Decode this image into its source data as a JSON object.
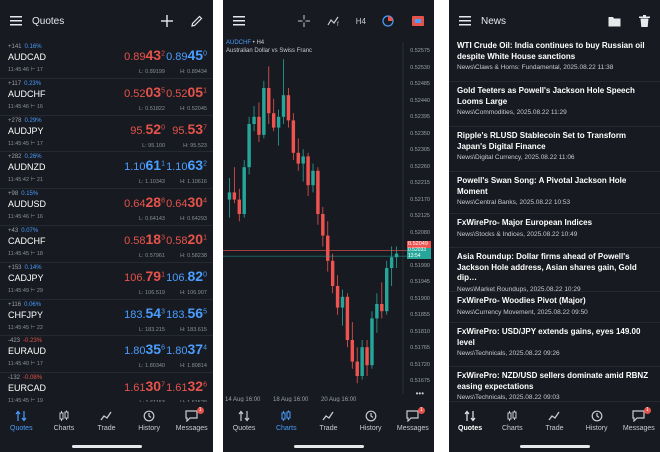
{
  "quotes": {
    "title": "Quotes",
    "rows": [
      {
        "change": "+141",
        "pct": "0.16%",
        "symbol": "AUDCAD",
        "time": "11:45:46",
        "spread": "17",
        "bid_main": "0.89",
        "bid_big": "43",
        "bid_sup": "2",
        "ask_main": "0.89",
        "ask_big": "45",
        "ask_sup": "0",
        "low": "L: 0.89199",
        "high": "H: 0.89434",
        "dir": "up",
        "bid_dir": "down",
        "ask_dir": "up"
      },
      {
        "change": "+117",
        "pct": "0.23%",
        "symbol": "AUDCHF",
        "time": "11:45:46",
        "spread": "16",
        "bid_main": "0.52",
        "bid_big": "03",
        "bid_sup": "5",
        "ask_main": "0.52",
        "ask_big": "05",
        "ask_sup": "1",
        "low": "L: 0.51822",
        "high": "H: 0.52045",
        "dir": "up",
        "bid_dir": "down",
        "ask_dir": "down"
      },
      {
        "change": "+278",
        "pct": "0.29%",
        "symbol": "AUDJPY",
        "time": "11:45:45",
        "spread": "17",
        "bid_main": "95.",
        "bid_big": "52",
        "bid_sup": "0",
        "ask_main": "95.",
        "ask_big": "53",
        "ask_sup": "7",
        "low": "L: 95.100",
        "high": "H: 95.523",
        "dir": "up",
        "bid_dir": "down",
        "ask_dir": "down"
      },
      {
        "change": "+282",
        "pct": "0.26%",
        "symbol": "AUDNZD",
        "time": "11:45:42",
        "spread": "21",
        "bid_main": "1.10",
        "bid_big": "61",
        "bid_sup": "1",
        "ask_main": "1.10",
        "ask_big": "63",
        "ask_sup": "2",
        "low": "L: 1.10343",
        "high": "H: 1.10616",
        "dir": "up",
        "bid_dir": "up",
        "ask_dir": "up"
      },
      {
        "change": "+98",
        "pct": "0.15%",
        "symbol": "AUDUSD",
        "time": "11:45:46",
        "spread": "16",
        "bid_main": "0.64",
        "bid_big": "28",
        "bid_sup": "8",
        "ask_main": "0.64",
        "ask_big": "30",
        "ask_sup": "4",
        "low": "L: 0.64143",
        "high": "H: 0.64293",
        "dir": "up",
        "bid_dir": "down",
        "ask_dir": "down"
      },
      {
        "change": "+43",
        "pct": "0.07%",
        "symbol": "CADCHF",
        "time": "11:45:45",
        "spread": "18",
        "bid_main": "0.58",
        "bid_big": "18",
        "bid_sup": "3",
        "ask_main": "0.58",
        "ask_big": "20",
        "ask_sup": "1",
        "low": "L: 0.57961",
        "high": "H: 0.58238",
        "dir": "up",
        "bid_dir": "down",
        "ask_dir": "down"
      },
      {
        "change": "+153",
        "pct": "0.14%",
        "symbol": "CADJPY",
        "time": "11:45:49",
        "spread": "29",
        "bid_main": "106.",
        "bid_big": "79",
        "bid_sup": "1",
        "ask_main": "106.",
        "ask_big": "82",
        "ask_sup": "0",
        "low": "L: 106.519",
        "high": "H: 106.907",
        "dir": "up",
        "bid_dir": "down",
        "ask_dir": "up"
      },
      {
        "change": "+116",
        "pct": "0.06%",
        "symbol": "CHFJPY",
        "time": "11:45:45",
        "spread": "22",
        "bid_main": "183.",
        "bid_big": "54",
        "bid_sup": "3",
        "ask_main": "183.",
        "ask_big": "56",
        "ask_sup": "5",
        "low": "L: 183.215",
        "high": "H: 183.615",
        "dir": "up",
        "bid_dir": "up",
        "ask_dir": "up"
      },
      {
        "change": "-423",
        "pct": "-0.23%",
        "symbol": "EURAUD",
        "time": "11:45:40",
        "spread": "17",
        "bid_main": "1.80",
        "bid_big": "35",
        "bid_sup": "6",
        "ask_main": "1.80",
        "ask_big": "37",
        "ask_sup": "4",
        "low": "L: 1.80340",
        "high": "H: 1.80814",
        "dir": "down",
        "bid_dir": "up",
        "ask_dir": "up"
      },
      {
        "change": "-132",
        "pct": "-0.08%",
        "symbol": "EURCAD",
        "time": "11:45:45",
        "spread": "19",
        "bid_main": "1.61",
        "bid_big": "30",
        "bid_sup": "7",
        "ask_main": "1.61",
        "ask_big": "32",
        "ask_sup": "6",
        "low": "L: 1.61153",
        "high": "H: 1.61529",
        "dir": "down",
        "bid_dir": "down",
        "ask_dir": "down"
      }
    ]
  },
  "chart": {
    "symbol": "AUDCHF",
    "timeframe_marker": "• H4",
    "description": "Australian Dollar vs Swiss Franc",
    "toolbar_timeframe": "H4",
    "price_labels": [
      "0.52575",
      "0.52530",
      "0.52485",
      "0.52440",
      "0.52395",
      "0.52350",
      "0.52305",
      "0.52260",
      "0.52215",
      "0.52170",
      "0.52125",
      "0.52080",
      "0.52035",
      "0.51990",
      "0.51945",
      "0.51900",
      "0.51855",
      "0.51810",
      "0.51765",
      "0.51720",
      "0.51675"
    ],
    "last_ask": "0.52049",
    "last_bid": "0.52033",
    "countdown": "13:54",
    "date_labels": [
      "14 Aug 16:00",
      "18 Aug 16:00",
      "20 Aug 16:00"
    ],
    "more_label": "•••",
    "colors": {
      "bull": "#26a69a",
      "bear": "#ef5350",
      "ask": "#ef5350",
      "bid": "#26a69a"
    }
  },
  "chart_data": {
    "type": "candlestick",
    "title": "AUDCHF H4",
    "ylim": [
      0.5165,
      0.526
    ],
    "candles": [
      [
        0.5219,
        0.5225,
        0.5214,
        0.5221
      ],
      [
        0.5221,
        0.5228,
        0.5218,
        0.5219
      ],
      [
        0.5219,
        0.5222,
        0.5213,
        0.5215
      ],
      [
        0.5215,
        0.523,
        0.5214,
        0.5228
      ],
      [
        0.5228,
        0.5242,
        0.5226,
        0.524
      ],
      [
        0.524,
        0.5245,
        0.5238,
        0.5242
      ],
      [
        0.5242,
        0.5246,
        0.5235,
        0.5237
      ],
      [
        0.5237,
        0.5252,
        0.5236,
        0.525
      ],
      [
        0.525,
        0.5256,
        0.524,
        0.5243
      ],
      [
        0.5243,
        0.5247,
        0.5238,
        0.5239
      ],
      [
        0.5239,
        0.5244,
        0.5234,
        0.5242
      ],
      [
        0.5242,
        0.5258,
        0.524,
        0.5248
      ],
      [
        0.5248,
        0.525,
        0.5239,
        0.5241
      ],
      [
        0.5241,
        0.5243,
        0.523,
        0.5232
      ],
      [
        0.5232,
        0.5236,
        0.5227,
        0.5229
      ],
      [
        0.5229,
        0.5233,
        0.5224,
        0.5231
      ],
      [
        0.5231,
        0.5232,
        0.522,
        0.5223
      ],
      [
        0.5223,
        0.5229,
        0.5221,
        0.5227
      ],
      [
        0.5227,
        0.5228,
        0.5212,
        0.5215
      ],
      [
        0.5215,
        0.5217,
        0.5206,
        0.5209
      ],
      [
        0.5209,
        0.5213,
        0.5199,
        0.5202
      ],
      [
        0.5202,
        0.5204,
        0.5193,
        0.5195
      ],
      [
        0.5195,
        0.5198,
        0.5187,
        0.5189
      ],
      [
        0.5189,
        0.5194,
        0.5184,
        0.5192
      ],
      [
        0.5192,
        0.5193,
        0.5178,
        0.518
      ],
      [
        0.518,
        0.5185,
        0.5172,
        0.5174
      ],
      [
        0.5174,
        0.5178,
        0.5168,
        0.517
      ],
      [
        0.517,
        0.518,
        0.5169,
        0.5178
      ],
      [
        0.5178,
        0.518,
        0.517,
        0.5173
      ],
      [
        0.5173,
        0.5188,
        0.5172,
        0.5186
      ],
      [
        0.5186,
        0.5193,
        0.5182,
        0.519
      ],
      [
        0.519,
        0.5196,
        0.5186,
        0.5188
      ],
      [
        0.5188,
        0.5202,
        0.5187,
        0.52
      ],
      [
        0.52,
        0.5206,
        0.5195,
        0.5203
      ],
      [
        0.5203,
        0.5206,
        0.52,
        0.5204
      ]
    ]
  },
  "news": {
    "title": "News",
    "items": [
      {
        "title": "WTI Crude Oil: India continues to buy Russian oil despite White House sanctions",
        "meta": "News\\Claws & Horns: Fundamental, 2025.08.22 11:38"
      },
      {
        "title": "Gold Teeters as Powell's Jackson Hole Speech Looms Large",
        "meta": "News\\Commodities, 2025.08.22 11:29"
      },
      {
        "title": "Ripple's RLUSD Stablecoin Set to Transform Japan's Digital Finance",
        "meta": "News\\Digital Currency, 2025.08.22 11:06"
      },
      {
        "title": "Powell's Swan Song: A Pivotal Jackson Hole Moment",
        "meta": "News\\Central Banks, 2025.08.22 10:53"
      },
      {
        "title": "FxWirePro- Major European Indices",
        "meta": "News\\Stocks & Indices, 2025.08.22 10:49"
      },
      {
        "title": "Asia Roundup: Dollar firms ahead of Powell's Jackson Hole address, Asian shares gain, Gold dip…",
        "meta": "News\\Market Roundups, 2025.08.22 10:29"
      },
      {
        "title": "FxWirePro- Woodies Pivot (Major)",
        "meta": "News\\Currency Movement, 2025.08.22 09:50"
      },
      {
        "title": "FxWirePro:  USD/JPY extends gains, eyes 149.00 level",
        "meta": "News\\Technicals, 2025.08.22 09:26"
      },
      {
        "title": "FxWirePro: NZD/USD sellers dominate amid RBNZ easing expectations",
        "meta": "News\\Technicals, 2025.08.22 09:03"
      }
    ]
  },
  "nav": {
    "quotes": "Quotes",
    "charts": "Charts",
    "trade": "Trade",
    "history": "History",
    "messages": "Messages",
    "badge": "1"
  }
}
